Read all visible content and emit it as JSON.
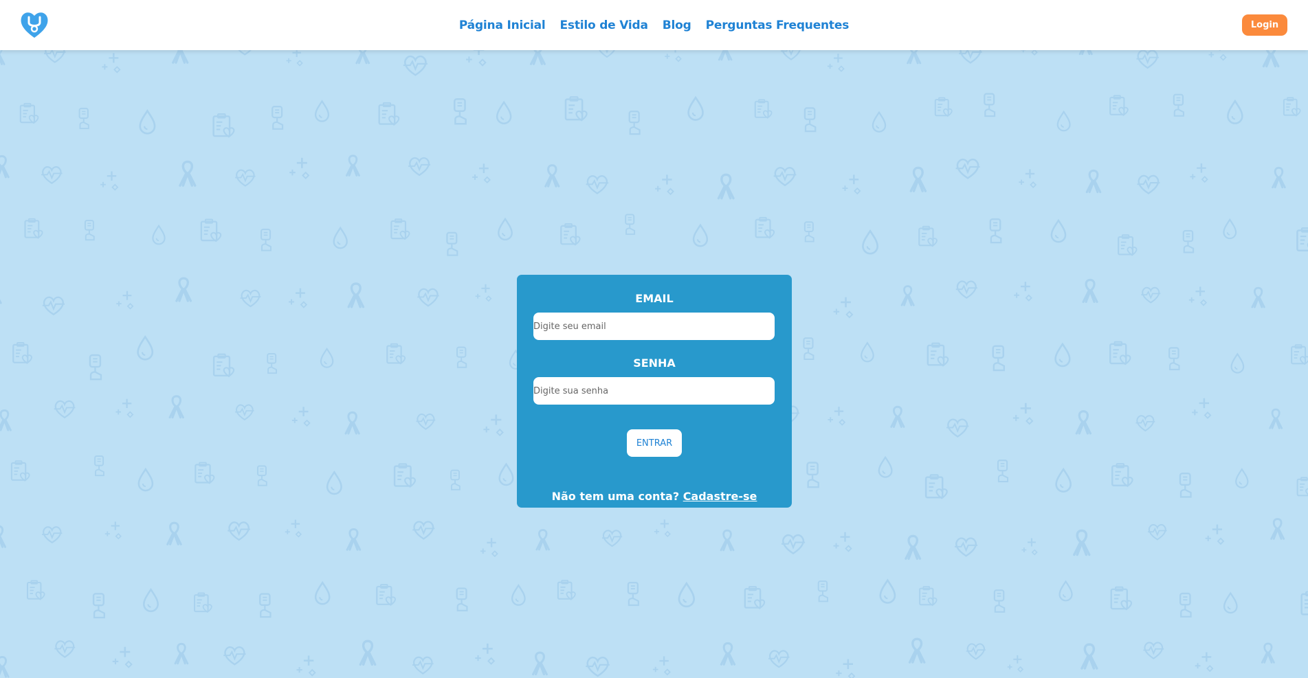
{
  "colors": {
    "background": "#bde0f5",
    "pattern_icon": "#a9d2ee",
    "header_background": "#ffffff",
    "nav_link": "#1f82d4",
    "login_button": "#fb8a3c",
    "card_background": "#2899cc",
    "logo": "#3fa3ea"
  },
  "header": {
    "logo_icon": "heart-stethoscope-logo-icon",
    "nav": [
      {
        "label": "Página Inicial"
      },
      {
        "label": "Estilo de Vida"
      },
      {
        "label": "Blog"
      },
      {
        "label": "Perguntas Frequentes"
      }
    ],
    "login_label": "Login"
  },
  "background_icons": [
    "awareness-ribbon-icon",
    "blood-drop-icon",
    "heart-pulse-icon",
    "clipboard-heart-icon",
    "plus-sparkle-icon",
    "glucose-meter-icon"
  ],
  "login_form": {
    "email_label": "EMAIL",
    "email_placeholder": "Digite seu email",
    "email_value": "",
    "password_label": "SENHA",
    "password_placeholder": "Digite sua senha",
    "password_value": "",
    "submit_label": "ENTRAR",
    "signup_prompt": "Não tem uma conta?",
    "signup_link": "Cadastre-se"
  }
}
